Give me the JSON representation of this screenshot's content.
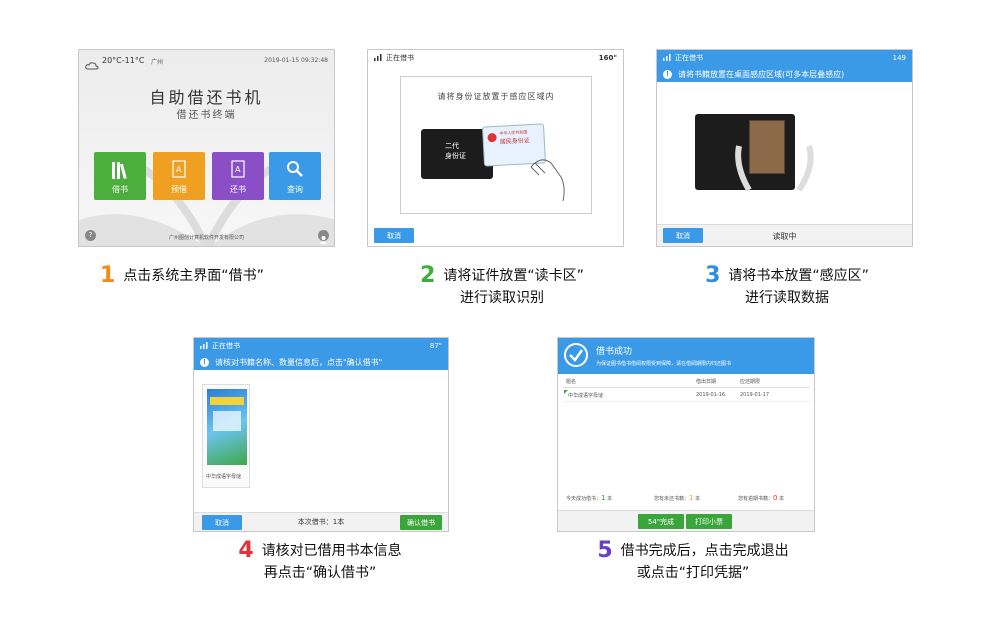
{
  "panel1": {
    "weather": "20°C-11°C",
    "city": "广州",
    "datetime": "2019-01-15  09:32:48",
    "title": "自助借还书机",
    "subtitle": "借还书终端",
    "tiles": [
      {
        "label": "借书",
        "color": "#4cae3c"
      },
      {
        "label": "预借",
        "color": "#f0a020"
      },
      {
        "label": "还书",
        "color": "#8a4fc7"
      },
      {
        "label": "查询",
        "color": "#3a9ae8"
      }
    ],
    "footer": "广州图创计算机软件开发有限公司",
    "help_icon": "question-icon",
    "user_icon": "user-icon"
  },
  "panel2": {
    "top_title": "正在借书",
    "countdown": "160\"",
    "instruction": "请将身份证放置于感应区域内",
    "reader_text": "二代\n身份证",
    "card_line1": "中华人民共和国",
    "card_line2": "居民身份证",
    "cancel": "取消"
  },
  "panel3": {
    "top_title": "正在借书",
    "countdown": "149",
    "notice": "请将书籍放置在桌面感应区域(可多本层叠感应)",
    "cancel": "取消",
    "status": "读取中"
  },
  "panel4": {
    "top_title": "正在借书",
    "countdown": "87\"",
    "notice": "请核对书籍名称、数量信息后，点击\"确认借书\"",
    "book_label": "中华成语字母谜",
    "cancel": "取消",
    "count_text": "本次借书：1本",
    "confirm": "确认借书"
  },
  "panel5": {
    "title": "借书成功",
    "subtitle": "为保证图书借书借阅权限受到保障，请在借阅期限内归还图书",
    "headers": [
      "题名",
      "借出日期",
      "应还期限"
    ],
    "rows": [
      [
        "中华成语字母谜",
        "2019-01-16",
        "2019-01-17"
      ]
    ],
    "stats": [
      {
        "label": "今天成功借书：",
        "value": "1",
        "unit": "本",
        "color": "#3a9a3a"
      },
      {
        "label": "您有未还书籍：",
        "value": "1",
        "unit": "本",
        "color": "#f0a020"
      },
      {
        "label": "您有逾期书籍：",
        "value": "0",
        "unit": "本",
        "color": "#e03030"
      }
    ],
    "done": "54\"完成",
    "print": "打印小票"
  },
  "captions": [
    {
      "num": "1",
      "color": "#f08a1a",
      "line1": "点击系统主界面“借书”",
      "line2": ""
    },
    {
      "num": "2",
      "color": "#3cae3c",
      "line1": "请将证件放置“读卡区”",
      "line2": "进行读取识别"
    },
    {
      "num": "3",
      "color": "#2e8ee0",
      "line1": "请将书本放置“感应区”",
      "line2": "进行读取数据"
    },
    {
      "num": "4",
      "color": "#e0343a",
      "line1": "请核对已借用书本信息",
      "line2": "再点击“确认借书”"
    },
    {
      "num": "5",
      "color": "#6a3fc8",
      "line1": "借书完成后，点击完成退出",
      "line2": "或点击“打印凭据”"
    }
  ]
}
